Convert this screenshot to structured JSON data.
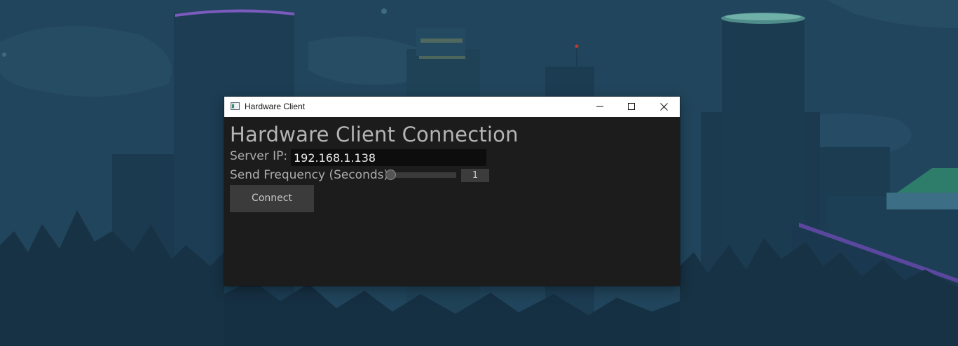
{
  "window": {
    "title": "Hardware Client"
  },
  "app": {
    "heading": "Hardware Client Connection",
    "server_ip_label": "Server IP:",
    "server_ip_value": "192.168.1.138",
    "frequency_label": "Send Frequency (Seconds):",
    "frequency_value": "1",
    "connect_label": "Connect"
  },
  "icons": [
    "app-icon",
    "minimize-icon",
    "maximize-icon",
    "close-icon"
  ]
}
